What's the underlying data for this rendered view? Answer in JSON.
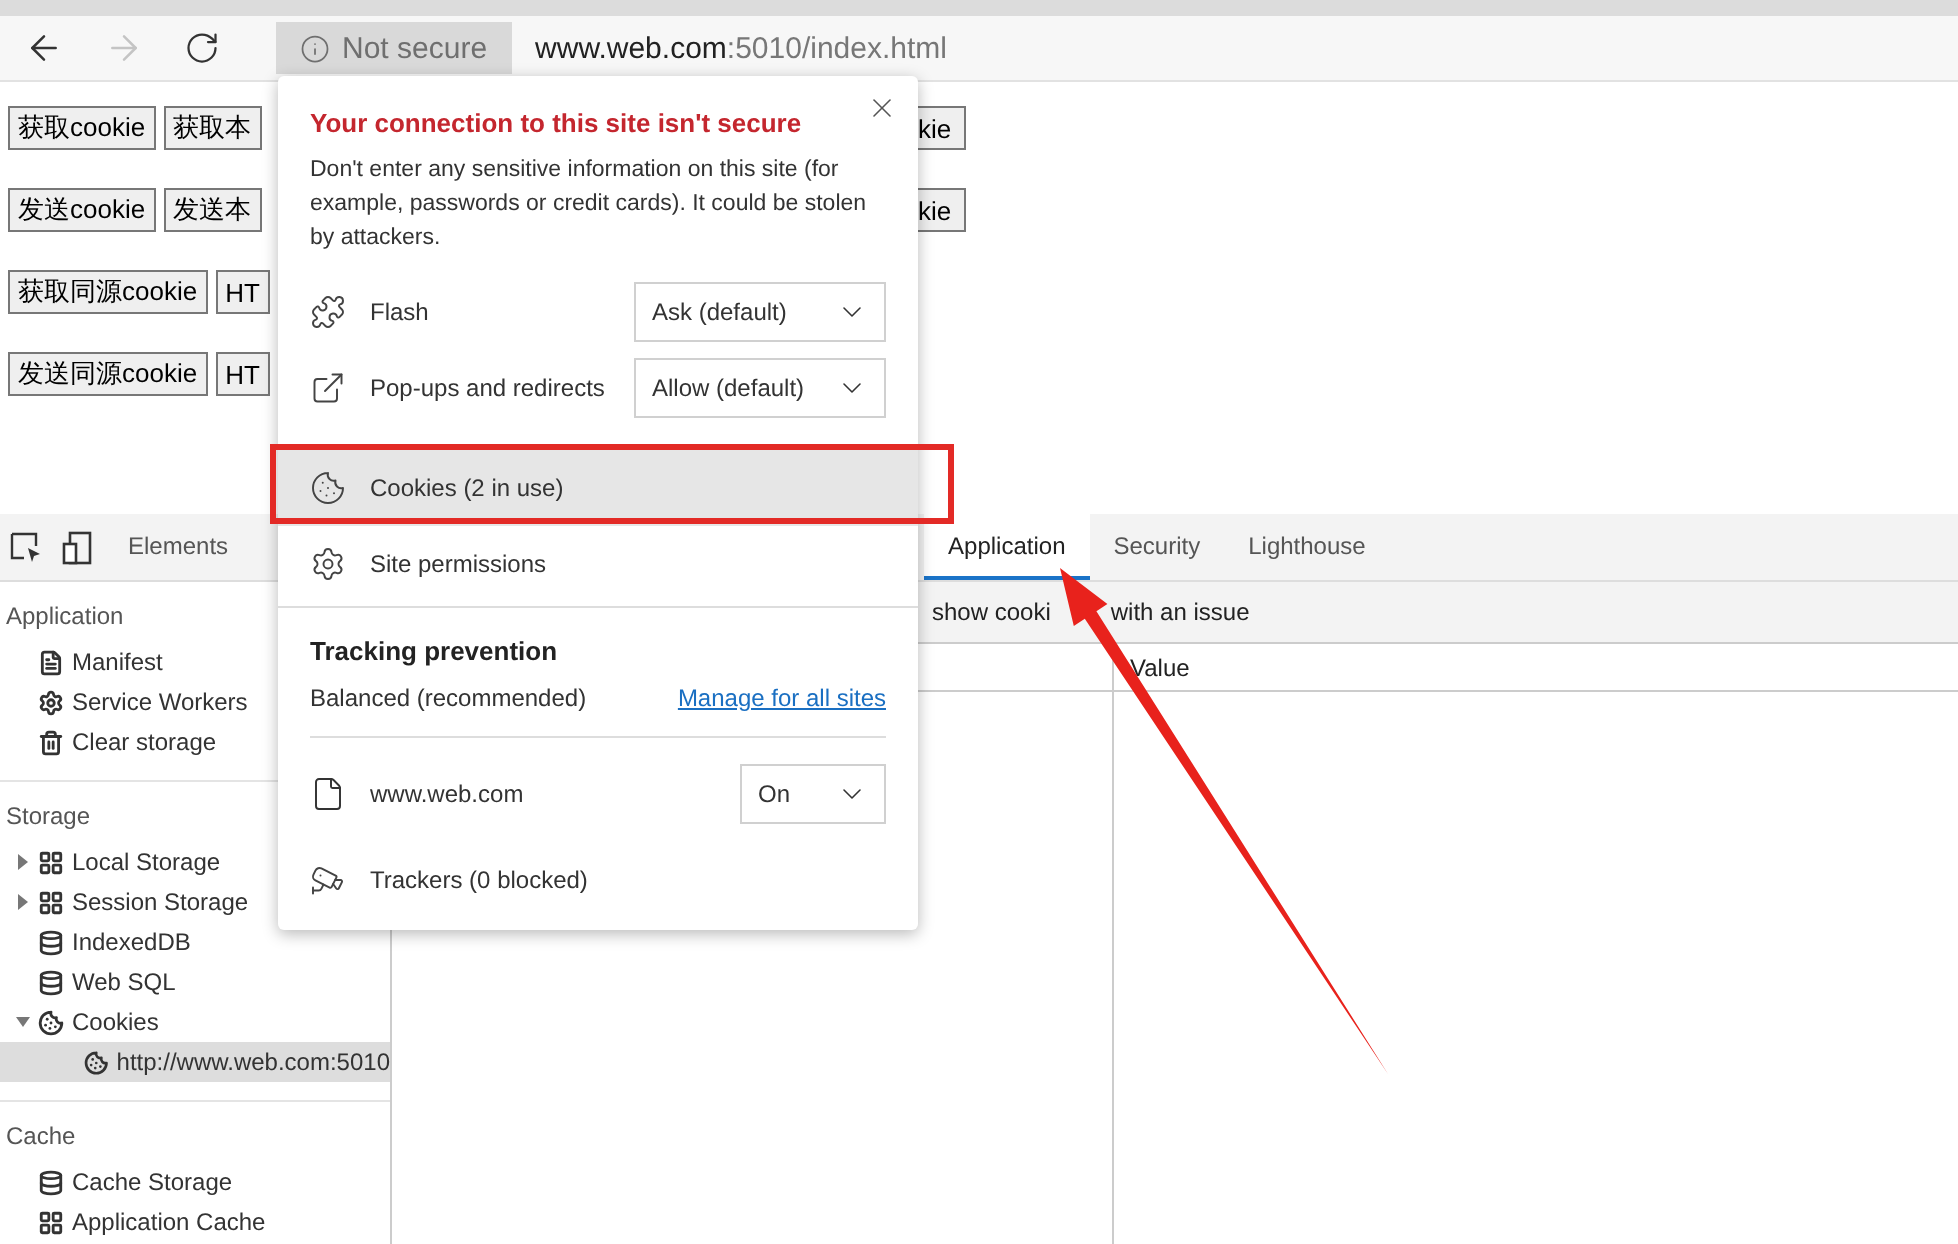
{
  "toolbar": {
    "security_chip": "Not secure",
    "url_host": "www.web.com",
    "url_rest": ":5010/index.html"
  },
  "page_rows": [
    {
      "left": [
        "获取cookie",
        "获取本"
      ],
      "right": "kie"
    },
    {
      "left": [
        "发送cookie",
        "发送本"
      ],
      "right": "kie"
    },
    {
      "left": [
        "获取同源cookie",
        "HT"
      ]
    },
    {
      "left": [
        "发送同源cookie",
        "HT"
      ]
    }
  ],
  "devtools": {
    "tabs": [
      {
        "label": "Elements",
        "selected": false
      },
      {
        "label": "Application",
        "selected": true
      },
      {
        "label": "Security",
        "selected": false
      },
      {
        "label": "Lighthouse",
        "selected": false
      }
    ],
    "sidebar": [
      {
        "title": "Application",
        "items": [
          {
            "label": "Manifest",
            "kind": "file",
            "selected": false
          },
          {
            "label": "Service Workers",
            "kind": "gear",
            "selected": false
          },
          {
            "label": "Clear storage",
            "kind": "trash",
            "selected": false
          }
        ]
      },
      {
        "title": "Storage",
        "items": [
          {
            "label": "Local Storage",
            "kind": "grid",
            "expanded": false,
            "selected": false
          },
          {
            "label": "Session Storage",
            "kind": "grid",
            "expanded": false,
            "selected": false
          },
          {
            "label": "IndexedDB",
            "kind": "database",
            "selected": false
          },
          {
            "label": "Web SQL",
            "kind": "database",
            "selected": false
          },
          {
            "label": "Cookies",
            "kind": "cookie",
            "expanded": true,
            "selected": false,
            "children": [
              {
                "label": "http://www.web.com:5010",
                "kind": "cookie",
                "selected": true
              }
            ]
          }
        ]
      },
      {
        "title": "Cache",
        "items": [
          {
            "label": "Cache Storage",
            "kind": "database",
            "selected": false
          },
          {
            "label": "Application Cache",
            "kind": "grid",
            "selected": false
          }
        ]
      }
    ],
    "filter_text": [
      "show cooki",
      "with an issue"
    ],
    "table": {
      "columns": [
        "Value"
      ]
    }
  },
  "popup": {
    "title": "Your connection to this site isn't secure",
    "description": "Don't enter any sensitive information on this site (for example, passwords or credit cards). It could be stolen by attackers.",
    "permissions": [
      {
        "label": "Flash",
        "kind": "puzzle",
        "value": "Ask (default)"
      },
      {
        "label": "Pop-ups and redirects",
        "kind": "external",
        "value": "Allow (default)"
      }
    ],
    "links": [
      {
        "label": "Cookies (2 in use)",
        "kind": "cookie",
        "highlighted": true
      },
      {
        "label": "Site permissions",
        "kind": "gear",
        "highlighted": false
      }
    ],
    "tracking": {
      "title": "Tracking prevention",
      "level": "Balanced (recommended)",
      "link": "Manage for all sites",
      "site": "www.web.com",
      "site_value": "On",
      "trackers": "Trackers (0 blocked)"
    }
  }
}
